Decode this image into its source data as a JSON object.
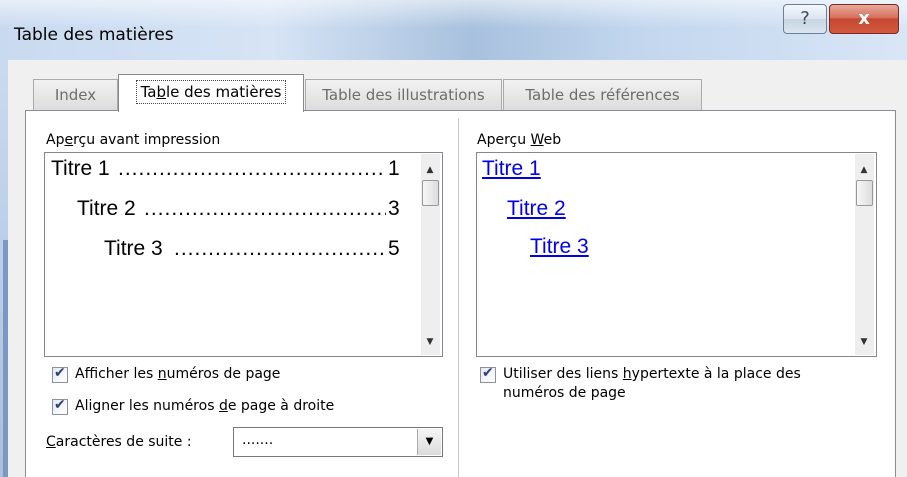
{
  "window": {
    "title": "Table des matières",
    "help_label": "?",
    "close_label": "x"
  },
  "tabs": [
    {
      "label": "Index",
      "active": false
    },
    {
      "label": "Table des matières",
      "active": true
    },
    {
      "label": "Table des illustrations",
      "active": false
    },
    {
      "label": "Table des références",
      "active": false
    }
  ],
  "print_preview": {
    "label": "Aperçu avant impression",
    "entries": [
      {
        "text": "Titre 1",
        "page": "1"
      },
      {
        "text": "Titre 2",
        "page": "3"
      },
      {
        "text": "Titre 3",
        "page": "5"
      }
    ]
  },
  "web_preview": {
    "label": "Aperçu Web",
    "entries": [
      "Titre 1",
      "Titre 2",
      "Titre 3"
    ]
  },
  "options": {
    "show_page_numbers": {
      "label": "Afficher les numéros de page",
      "checked": true
    },
    "align_right": {
      "label": "Aligner les numéros de page à droite",
      "checked": true
    },
    "tab_leader_label": "Caractères de suite :",
    "tab_leader_value": ".......",
    "use_hyperlinks": {
      "label_line1": "Utiliser des liens hypertexte à la place des",
      "label_line2": "numéros de page",
      "checked": true
    }
  },
  "icons": {
    "scroll_up": "▲",
    "scroll_down": "▼",
    "checkmark": "✔",
    "dropdown": "▼"
  }
}
